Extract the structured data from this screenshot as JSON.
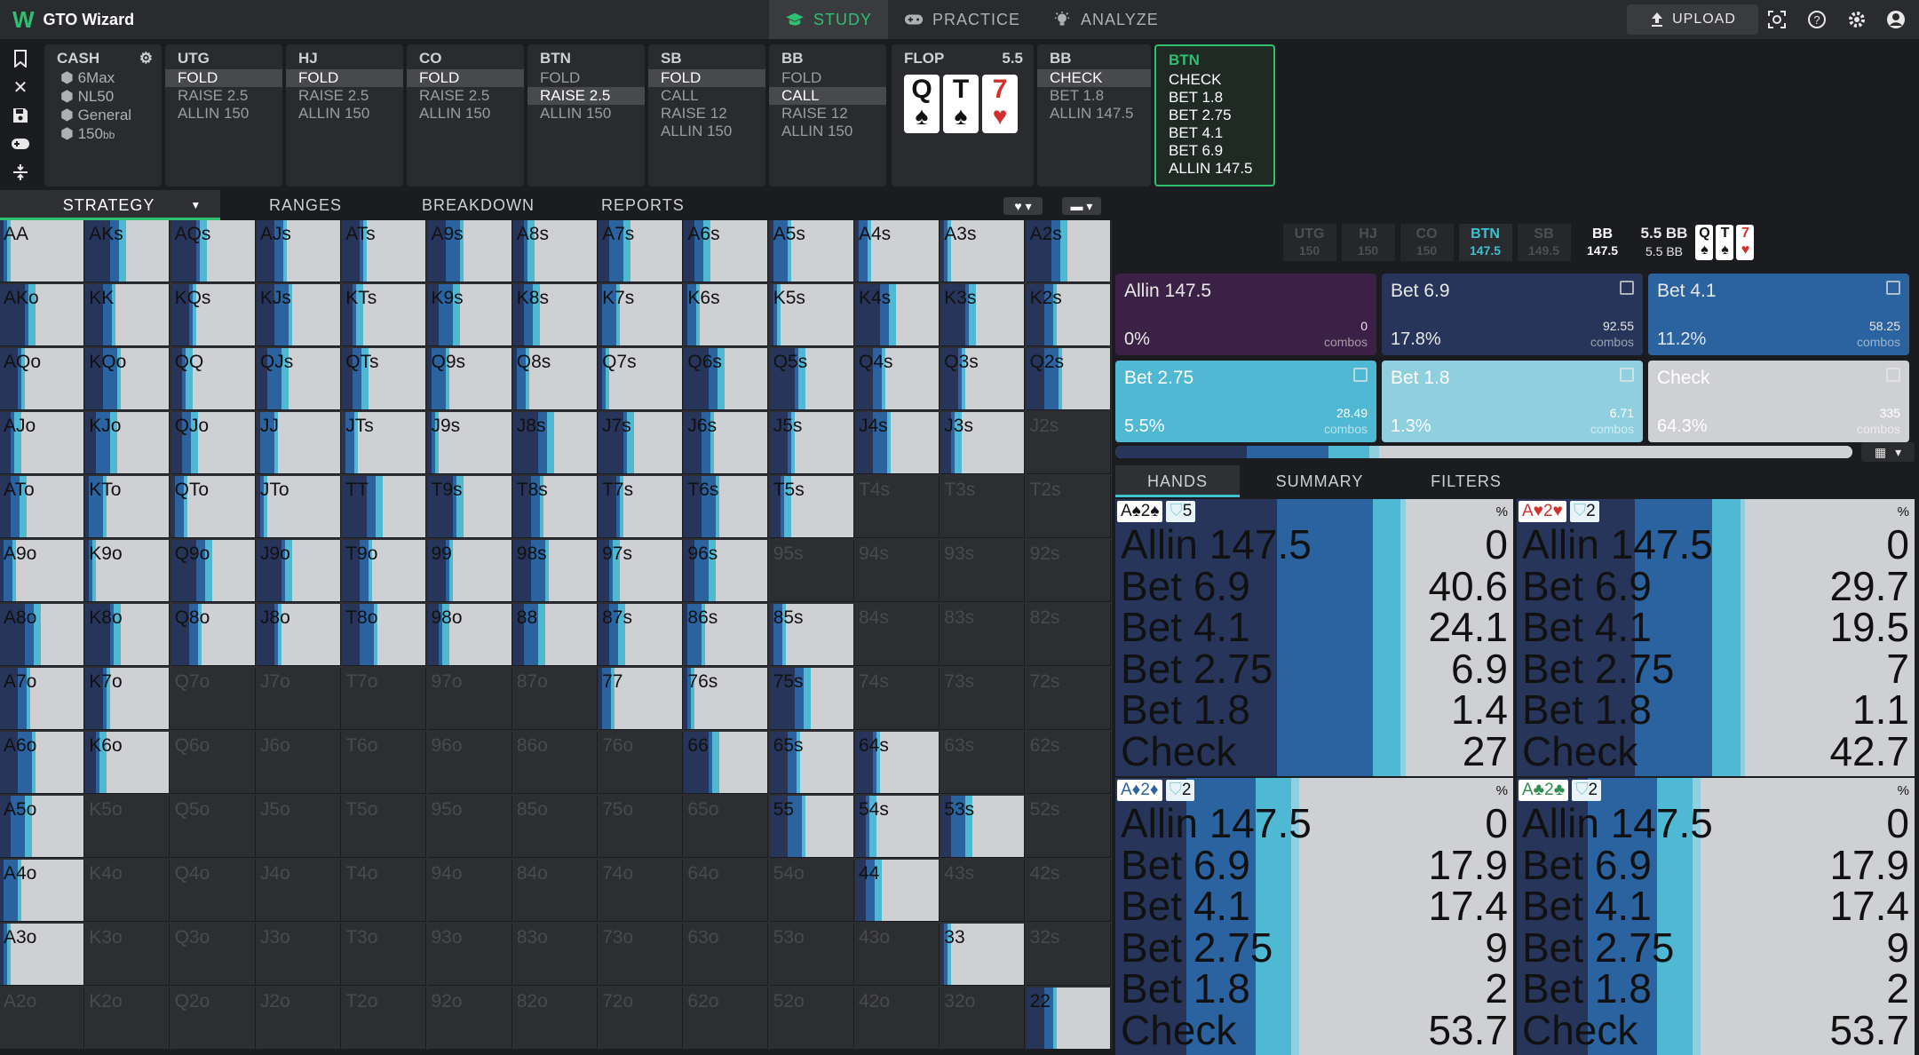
{
  "app": {
    "logo": "W",
    "title": "GTO Wizard"
  },
  "nav": {
    "modes": [
      {
        "label": "STUDY",
        "active": true
      },
      {
        "label": "PRACTICE",
        "active": false
      },
      {
        "label": "ANALYZE",
        "active": false
      }
    ],
    "upload": "UPLOAD"
  },
  "game": {
    "title": "CASH",
    "format": "6Max",
    "stakes": "NL50",
    "type": "General",
    "stack": "150",
    "stack_unit": "bb"
  },
  "positions": [
    {
      "pos": "UTG",
      "actions": [
        "FOLD",
        "RAISE 2.5",
        "ALLIN 150"
      ],
      "selected": 0
    },
    {
      "pos": "HJ",
      "actions": [
        "FOLD",
        "RAISE 2.5",
        "ALLIN 150"
      ],
      "selected": 0
    },
    {
      "pos": "CO",
      "actions": [
        "FOLD",
        "RAISE 2.5",
        "ALLIN 150"
      ],
      "selected": 0
    },
    {
      "pos": "BTN",
      "actions": [
        "FOLD",
        "RAISE 2.5",
        "ALLIN 150"
      ],
      "selected": 1
    },
    {
      "pos": "SB",
      "actions": [
        "FOLD",
        "CALL",
        "RAISE 12",
        "ALLIN 150"
      ],
      "selected": 0
    },
    {
      "pos": "BB",
      "actions": [
        "FOLD",
        "CALL",
        "RAISE 12",
        "ALLIN 150"
      ],
      "selected": 1
    }
  ],
  "flop": {
    "label": "FLOP",
    "pot": "5.5",
    "cards": [
      {
        "rank": "Q",
        "suit": "♠",
        "color": "#111"
      },
      {
        "rank": "T",
        "suit": "♠",
        "color": "#111"
      },
      {
        "rank": "7",
        "suit": "♥",
        "color": "#d0312d"
      }
    ]
  },
  "bb_node": {
    "pos": "BB",
    "actions": [
      "CHECK",
      "BET 1.8",
      "ALLIN 147.5"
    ],
    "selected": 0
  },
  "btn_node": {
    "pos": "BTN",
    "actions": [
      "CHECK",
      "BET 1.8",
      "BET 2.75",
      "BET 4.1",
      "BET 6.9",
      "ALLIN 147.5"
    ]
  },
  "tabs": [
    "STRATEGY",
    "RANGES",
    "BREAKDOWN",
    "REPORTS"
  ],
  "path": [
    {
      "pos": "UTG",
      "stack": "150"
    },
    {
      "pos": "HJ",
      "stack": "150"
    },
    {
      "pos": "CO",
      "stack": "150"
    },
    {
      "pos": "BTN",
      "stack": "147.5"
    },
    {
      "pos": "SB",
      "stack": "149.5"
    },
    {
      "pos": "BB",
      "stack": "147.5"
    }
  ],
  "pot": {
    "top": "5.5 BB",
    "bottom": "5.5 BB"
  },
  "mini_cards": [
    {
      "rank": "Q",
      "suit": "♠",
      "color": "#111"
    },
    {
      "rank": "T",
      "suit": "♠",
      "color": "#111"
    },
    {
      "rank": "7",
      "suit": "♥",
      "color": "#d0312d"
    }
  ],
  "colors": {
    "allin": "#3c2146",
    "bet69": "#263559",
    "bet41": "#2a63a0",
    "bet275": "#4fb8d2",
    "bet18": "#8fcfe0",
    "check": "#cfd0d3"
  },
  "actions": [
    {
      "name": "Allin 147.5",
      "pct": "0%",
      "combos": "0",
      "combo_label": "combos",
      "bg": "#3c2146",
      "fg": "#e8e8e8"
    },
    {
      "name": "Bet 6.9",
      "pct": "17.8%",
      "combos": "92.55",
      "combo_label": "combos",
      "bg": "#263559",
      "fg": "#e8e8e8"
    },
    {
      "name": "Bet 4.1",
      "pct": "11.2%",
      "combos": "58.25",
      "combo_label": "combos",
      "bg": "#2a63a0",
      "fg": "#e8e8e8"
    },
    {
      "name": "Bet 2.75",
      "pct": "5.5%",
      "combos": "28.49",
      "combo_label": "combos",
      "bg": "#4fb8d2",
      "fg": "#fff"
    },
    {
      "name": "Bet 1.8",
      "pct": "1.3%",
      "combos": "6.71",
      "combo_label": "combos",
      "bg": "#8fcfe0",
      "fg": "#fff"
    },
    {
      "name": "Check",
      "pct": "64.3%",
      "combos": "335",
      "combo_label": "combos",
      "bg": "#cfd0d3",
      "fg": "#fff"
    }
  ],
  "hand_tabs": [
    "HANDS",
    "SUMMARY",
    "FILTERS"
  ],
  "hands": [
    {
      "cards": "A♠2♠",
      "count": "5",
      "pct_label": "%",
      "rows": [
        [
          "Allin 147.5",
          "0"
        ],
        [
          "Bet 6.9",
          "40.6"
        ],
        [
          "Bet 4.1",
          "24.1"
        ],
        [
          "Bet 2.75",
          "6.9"
        ],
        [
          "Bet 1.8",
          "1.4"
        ],
        [
          "Check",
          "27"
        ]
      ]
    },
    {
      "cards": "A♥2♥",
      "count": "2",
      "pct_label": "%",
      "rows": [
        [
          "Allin 147.5",
          "0"
        ],
        [
          "Bet 6.9",
          "29.7"
        ],
        [
          "Bet 4.1",
          "19.5"
        ],
        [
          "Bet 2.75",
          "7"
        ],
        [
          "Bet 1.8",
          "1.1"
        ],
        [
          "Check",
          "42.7"
        ]
      ]
    },
    {
      "cards": "A♦2♦",
      "count": "2",
      "pct_label": "%",
      "rows": [
        [
          "Allin 147.5",
          "0"
        ],
        [
          "Bet 6.9",
          "17.9"
        ],
        [
          "Bet 4.1",
          "17.4"
        ],
        [
          "Bet 2.75",
          "9"
        ],
        [
          "Bet 1.8",
          "2"
        ],
        [
          "Check",
          "53.7"
        ]
      ]
    },
    {
      "cards": "A♣2♣",
      "count": "2",
      "pct_label": "%",
      "rows": [
        [
          "Allin 147.5",
          "0"
        ],
        [
          "Bet 6.9",
          "17.9"
        ],
        [
          "Bet 4.1",
          "17.4"
        ],
        [
          "Bet 2.75",
          "9"
        ],
        [
          "Bet 1.8",
          "2"
        ],
        [
          "Check",
          "53.7"
        ]
      ]
    }
  ],
  "grid": [
    [
      "AA",
      "AKs",
      "AQs",
      "AJs",
      "ATs",
      "A9s",
      "A8s",
      "A7s",
      "A6s",
      "A5s",
      "A4s",
      "A3s",
      "A2s"
    ],
    [
      "AKo",
      "KK",
      "KQs",
      "KJs",
      "KTs",
      "K9s",
      "K8s",
      "K7s",
      "K6s",
      "K5s",
      "K4s",
      "K3s",
      "K2s"
    ],
    [
      "AQo",
      "KQo",
      "QQ",
      "QJs",
      "QTs",
      "Q9s",
      "Q8s",
      "Q7s",
      "Q6s",
      "Q5s",
      "Q4s",
      "Q3s",
      "Q2s"
    ],
    [
      "AJo",
      "KJo",
      "QJo",
      "JJ",
      "JTs",
      "J9s",
      "J8s",
      "J7s",
      "J6s",
      "J5s",
      "J4s",
      "J3s",
      "J2s"
    ],
    [
      "ATo",
      "KTo",
      "QTo",
      "JTo",
      "TT",
      "T9s",
      "T8s",
      "T7s",
      "T6s",
      "T5s",
      "T4s",
      "T3s",
      "T2s"
    ],
    [
      "A9o",
      "K9o",
      "Q9o",
      "J9o",
      "T9o",
      "99",
      "98s",
      "97s",
      "96s",
      "95s",
      "94s",
      "93s",
      "92s"
    ],
    [
      "A8o",
      "K8o",
      "Q8o",
      "J8o",
      "T8o",
      "98o",
      "88",
      "87s",
      "86s",
      "85s",
      "84s",
      "83s",
      "82s"
    ],
    [
      "A7o",
      "K7o",
      "Q7o",
      "J7o",
      "T7o",
      "97o",
      "87o",
      "77",
      "76s",
      "75s",
      "74s",
      "73s",
      "72s"
    ],
    [
      "A6o",
      "K6o",
      "Q6o",
      "J6o",
      "T6o",
      "96o",
      "86o",
      "76o",
      "66",
      "65s",
      "64s",
      "63s",
      "62s"
    ],
    [
      "A5o",
      "K5o",
      "Q5o",
      "J5o",
      "T5o",
      "95o",
      "85o",
      "75o",
      "65o",
      "55",
      "54s",
      "53s",
      "52s"
    ],
    [
      "A4o",
      "K4o",
      "Q4o",
      "J4o",
      "T4o",
      "94o",
      "84o",
      "74o",
      "64o",
      "54o",
      "44",
      "43s",
      "42s"
    ],
    [
      "A3o",
      "K3o",
      "Q3o",
      "J3o",
      "T3o",
      "93o",
      "83o",
      "73o",
      "63o",
      "53o",
      "43o",
      "33",
      "32s"
    ],
    [
      "A2o",
      "K2o",
      "Q2o",
      "J2o",
      "T2o",
      "92o",
      "82o",
      "72o",
      "62o",
      "52o",
      "42o",
      "32o",
      "22"
    ]
  ]
}
